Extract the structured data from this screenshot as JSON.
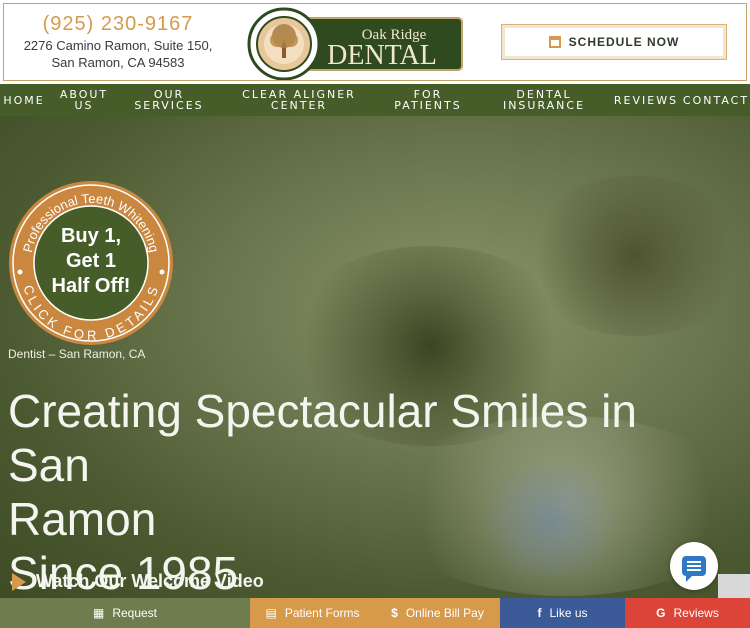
{
  "header": {
    "phone": "(925) 230-9167",
    "address_line1": "2276 Camino Ramon, Suite 150,",
    "address_line2": "San Ramon, CA 94583",
    "logo_top": "Oak Ridge",
    "logo_main": "DENTAL",
    "schedule_label": "SCHEDULE NOW"
  },
  "nav": [
    {
      "l1": "HOME",
      "l2": ""
    },
    {
      "l1": "ABOUT",
      "l2": "US"
    },
    {
      "l1": "OUR",
      "l2": "SERVICES"
    },
    {
      "l1": "CLEAR ALIGNER",
      "l2": "CENTER"
    },
    {
      "l1": "FOR",
      "l2": "PATIENTS"
    },
    {
      "l1": "DENTAL",
      "l2": "INSURANCE"
    },
    {
      "l1": "REVIEWS",
      "l2": ""
    },
    {
      "l1": "CONTACT",
      "l2": ""
    }
  ],
  "promo": {
    "arc_top": "Professional Teeth Whitening",
    "line1": "Buy 1,",
    "line2": "Get 1",
    "line3": "Half Off!",
    "arc_bottom": "CLICK FOR DETAILS"
  },
  "hero": {
    "caption": "Dentist – San Ramon, CA",
    "headline_l1": "Creating Spectacular Smiles in San",
    "headline_l2": "Ramon",
    "headline_l3": "Since 1985",
    "video_label": "Watch Our Welcome Video"
  },
  "bottom_bar": [
    {
      "label": "Request",
      "icon": "calendar-icon",
      "color": "#6e7d4e"
    },
    {
      "label": "Patient Forms",
      "icon": "document-icon",
      "color": "#d69a4a"
    },
    {
      "label": "Online Bill Pay",
      "icon": "dollar-icon",
      "color": "#d69a4a"
    },
    {
      "label": "Like us",
      "icon": "facebook-icon",
      "color": "#3c5a98"
    },
    {
      "label": "Reviews",
      "icon": "google-icon",
      "color": "#db4437"
    }
  ],
  "colors": {
    "accent": "#d69a4a",
    "nav_green": "#465d2a",
    "logo_green": "#2e4a1e"
  }
}
